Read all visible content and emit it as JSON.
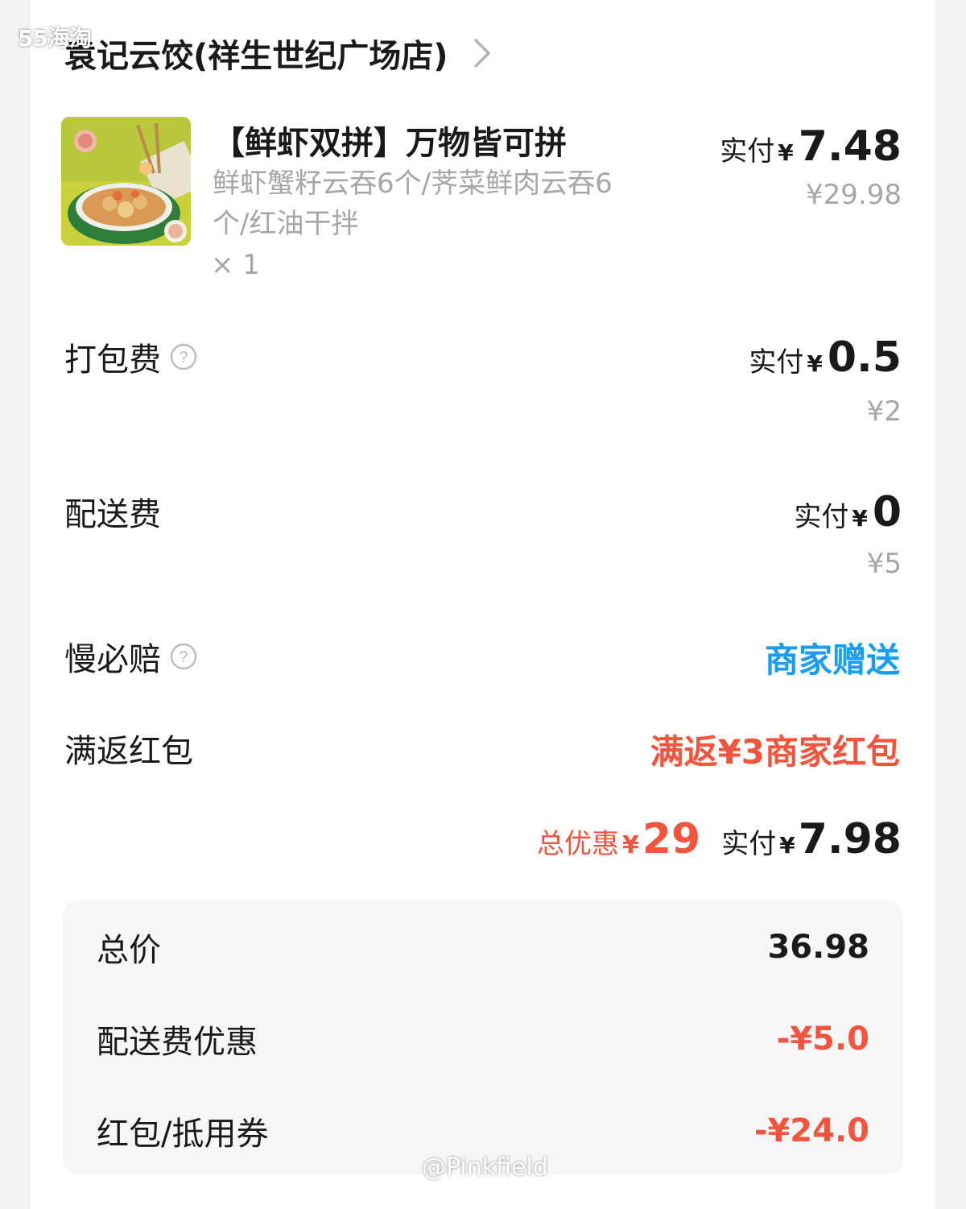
{
  "watermarks": {
    "top": "55海淘",
    "bottom": "@Pinkfield"
  },
  "store": {
    "name": "袁记云饺(祥生世纪广场店)",
    "arrow_icon": "chevron-right-icon"
  },
  "item": {
    "title": "【鲜虾双拼】万物皆可拼",
    "description": "鲜虾蟹籽云吞6个/荠菜鲜肉云吞6个/红油干拌",
    "quantity": "× 1",
    "paid_label": "实付",
    "currency": "¥",
    "paid_amount": "7.48",
    "original_price": "¥29.98"
  },
  "packing_fee": {
    "label": "打包费",
    "paid_label": "实付",
    "currency": "¥",
    "paid_amount": "0.5",
    "original_price": "¥2"
  },
  "delivery_fee": {
    "label": "配送费",
    "paid_label": "实付",
    "currency": "¥",
    "paid_amount": "0",
    "original_price": "¥5"
  },
  "late_guarantee": {
    "label": "慢必赔",
    "value": "商家赠送"
  },
  "rebate": {
    "label": "满返红包",
    "value": "满返¥3商家红包"
  },
  "summary": {
    "discount_label": "总优惠",
    "currency": "¥",
    "discount_amount": "29",
    "paid_label": "实付",
    "paid_amount": "7.98"
  },
  "breakdown": [
    {
      "label": "总价",
      "value": "36.98"
    },
    {
      "label": "配送费优惠",
      "value": "-¥5.0"
    },
    {
      "label": "红包/抵用券",
      "value": "-¥24.0"
    }
  ],
  "colors": {
    "accent_blue": "#1a9cf0",
    "accent_red": "#f2553d",
    "muted": "#a6a6a6"
  }
}
